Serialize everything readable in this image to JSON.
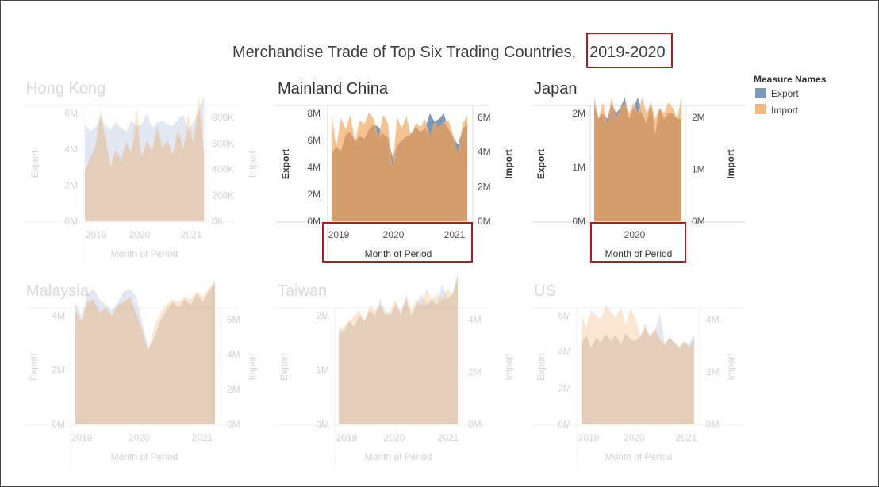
{
  "title_prefix": "Merchandise Trade of Top Six Trading Countries, ",
  "title_years": "2019-2020",
  "legend": {
    "title": "Measure Names",
    "items": [
      {
        "label": "Export",
        "color": "#7b98bd"
      },
      {
        "label": "Import",
        "color": "#f4b77c"
      }
    ]
  },
  "colors": {
    "export": "#7b98bd",
    "import": "#f4b77c",
    "overlap": "#d39a6b",
    "highlight_box": "#b11c1c"
  },
  "chart_data": [
    {
      "type": "area",
      "country": "Hong Kong",
      "faded": true,
      "xlabel": "Month of Period",
      "ylabel_left": "Export",
      "ylabel_right": "Import",
      "x_ticks": [
        "2019",
        "2020",
        "2021"
      ],
      "left_ticks": [
        "6M",
        "4M",
        "2M",
        "0M"
      ],
      "right_ticks": [
        "800K",
        "600K",
        "400K",
        "200K",
        "0K"
      ],
      "series": [
        {
          "name": "Export",
          "values": [
            5.4,
            5.0,
            5.2,
            5.8,
            5.3,
            5.1,
            5.5,
            5.2,
            5.0,
            5.6,
            5.3,
            5.4,
            6.0,
            5.2,
            5.5,
            5.6,
            5.4,
            5.3,
            5.7,
            5.9,
            5.1,
            5.5,
            6.2,
            7.0
          ]
        },
        {
          "name": "Import",
          "values": [
            2.8,
            3.5,
            4.1,
            6.2,
            4.6,
            3.0,
            4.0,
            3.4,
            4.4,
            3.8,
            6.4,
            3.6,
            4.5,
            3.9,
            5.3,
            4.1,
            4.5,
            3.7,
            5.1,
            4.0,
            6.0,
            4.4,
            7.1,
            3.9
          ]
        }
      ]
    },
    {
      "type": "area",
      "country": "Mainland China",
      "faded": false,
      "highlight_x": true,
      "xlabel": "Month of Period",
      "ylabel_left": "Export",
      "ylabel_right": "Import",
      "x_ticks": [
        "2019",
        "2020",
        "2021"
      ],
      "left_ticks": [
        "8M",
        "6M",
        "4M",
        "2M",
        "0M"
      ],
      "right_ticks": [
        "6M",
        "4M",
        "2M",
        "0M"
      ],
      "series": [
        {
          "name": "Export",
          "values": [
            5.0,
            5.6,
            5.2,
            6.4,
            6.6,
            6.0,
            6.3,
            6.1,
            6.8,
            7.2,
            7.0,
            6.5,
            6.2,
            4.8,
            5.6,
            6.0,
            6.3,
            6.5,
            7.0,
            6.6,
            6.9,
            8.0,
            7.4,
            7.6,
            8.0,
            6.8,
            6.2,
            5.7,
            6.8,
            7.2
          ]
        },
        {
          "name": "Import",
          "values": [
            7.9,
            5.5,
            7.7,
            6.8,
            7.9,
            5.9,
            7.5,
            7.2,
            8.1,
            7.6,
            6.2,
            7.9,
            7.3,
            4.0,
            7.7,
            6.9,
            7.8,
            6.3,
            7.3,
            7.0,
            7.6,
            6.3,
            7.4,
            7.0,
            7.4,
            7.5,
            6.4,
            5.0,
            7.2,
            7.9
          ]
        }
      ]
    },
    {
      "type": "area",
      "country": "Japan",
      "faded": false,
      "highlight_x": true,
      "xlabel": "Month of Period",
      "ylabel_left": "Export",
      "ylabel_right": "Import",
      "x_ticks": [
        "2020"
      ],
      "left_ticks": [
        "2M",
        "1M",
        "0M"
      ],
      "right_ticks": [
        "2M",
        "1M",
        "0M"
      ],
      "series": [
        {
          "name": "Export",
          "values": [
            2.15,
            1.9,
            2.0,
            1.9,
            2.2,
            2.0,
            2.1,
            2.3,
            1.9,
            2.1,
            2.3,
            2.0,
            1.8,
            2.2,
            1.6,
            2.1,
            1.9,
            2.0,
            2.0,
            1.9,
            1.9
          ]
        },
        {
          "name": "Import",
          "values": [
            2.3,
            1.9,
            2.2,
            1.8,
            2.3,
            1.9,
            2.1,
            2.2,
            2.0,
            2.2,
            2.0,
            2.3,
            2.0,
            2.2,
            1.9,
            2.1,
            2.0,
            2.2,
            2.1,
            1.9,
            2.3
          ]
        }
      ]
    },
    {
      "type": "area",
      "country": "Malaysia",
      "faded": true,
      "xlabel": "Month of Period",
      "ylabel_left": "Export",
      "ylabel_right": "Import",
      "x_ticks": [
        "2019",
        "2020",
        "2021"
      ],
      "left_ticks": [
        "4M",
        "2M",
        "0M"
      ],
      "right_ticks": [
        "6M",
        "4M",
        "2M",
        "0M"
      ],
      "series": [
        {
          "name": "Export",
          "values": [
            4.5,
            4.0,
            4.8,
            5.0,
            4.6,
            4.4,
            4.2,
            4.5,
            4.9,
            5.0,
            4.7,
            3.8,
            2.8,
            3.2,
            3.8,
            4.2,
            4.5,
            4.3,
            4.6,
            4.4,
            4.8,
            4.5,
            4.9,
            5.2
          ]
        },
        {
          "name": "Import",
          "values": [
            4.2,
            3.8,
            4.5,
            4.6,
            4.1,
            4.3,
            4.0,
            4.4,
            4.5,
            4.7,
            4.1,
            3.5,
            2.7,
            3.6,
            4.1,
            4.4,
            4.6,
            4.5,
            4.7,
            4.6,
            4.9,
            4.7,
            5.0,
            5.3
          ]
        }
      ]
    },
    {
      "type": "area",
      "country": "Taiwan",
      "faded": true,
      "xlabel": "Month of Period",
      "ylabel_left": "Export",
      "ylabel_right": "Import",
      "x_ticks": [
        "2019",
        "2020",
        "2021"
      ],
      "left_ticks": [
        "2M",
        "1M",
        "0M"
      ],
      "right_ticks": [
        "4M",
        "2M",
        "0M"
      ],
      "series": [
        {
          "name": "Export",
          "values": [
            1.8,
            1.7,
            1.9,
            1.8,
            2.0,
            1.9,
            2.1,
            2.0,
            2.3,
            2.1,
            2.0,
            2.2,
            2.1,
            2.3,
            2.0,
            2.2,
            2.4,
            2.2,
            2.3,
            2.2,
            2.6,
            2.3,
            2.4,
            2.8
          ]
        },
        {
          "name": "Import",
          "values": [
            1.7,
            1.8,
            1.9,
            2.0,
            2.1,
            1.9,
            2.2,
            2.1,
            2.2,
            2.0,
            2.1,
            2.3,
            2.0,
            2.4,
            2.1,
            2.3,
            2.2,
            2.5,
            2.3,
            2.4,
            2.3,
            2.5,
            2.4,
            2.7
          ]
        }
      ]
    },
    {
      "type": "area",
      "country": "US",
      "faded": true,
      "xlabel": "Month of Period",
      "ylabel_left": "Export",
      "ylabel_right": "Import",
      "x_ticks": [
        "2019",
        "2020",
        "2021"
      ],
      "left_ticks": [
        "6M",
        "4M",
        "2M",
        "0M"
      ],
      "right_ticks": [
        "4M",
        "2M",
        "0M"
      ],
      "series": [
        {
          "name": "Export",
          "values": [
            4.5,
            4.9,
            4.2,
            4.8,
            4.5,
            5.0,
            4.6,
            4.9,
            4.4,
            5.0,
            4.7,
            4.6,
            4.9,
            5.3,
            4.8,
            5.2,
            6.1,
            4.4,
            4.8,
            4.5,
            4.2,
            4.6,
            4.4,
            5.0
          ]
        },
        {
          "name": "Import",
          "values": [
            6.0,
            5.4,
            6.3,
            6.0,
            5.8,
            6.6,
            6.2,
            5.9,
            6.5,
            5.5,
            6.4,
            5.9,
            4.8,
            5.6,
            4.9,
            5.3,
            4.7,
            4.4,
            4.8,
            4.5,
            4.3,
            4.6,
            4.2,
            4.8
          ]
        }
      ]
    }
  ]
}
